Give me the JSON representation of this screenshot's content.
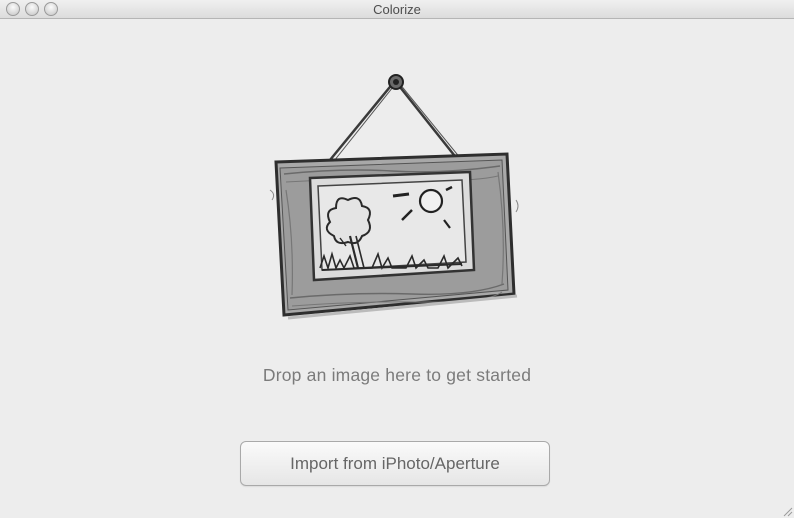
{
  "window": {
    "title": "Colorize",
    "controls": [
      "close",
      "minimize",
      "zoom"
    ]
  },
  "main": {
    "illustration": "framed-picture-sketch-icon",
    "prompt": "Drop an image here to get started",
    "import_button_label": "Import from iPhoto/Aperture"
  },
  "colors": {
    "background": "#ededed",
    "text": "#7b7b7b",
    "button_text": "#666666"
  }
}
